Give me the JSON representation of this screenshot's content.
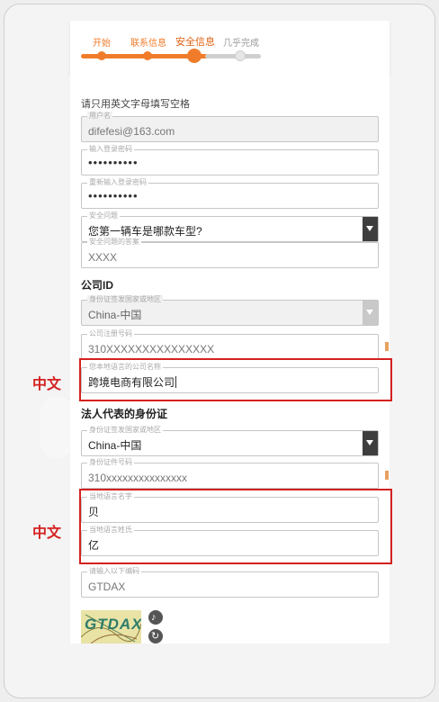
{
  "progress": {
    "steps": [
      {
        "label": "开始",
        "state": "done"
      },
      {
        "label": "联系信息",
        "state": "done"
      },
      {
        "label": "安全信息",
        "state": "active"
      },
      {
        "label": "几乎完成",
        "state": "todo"
      }
    ]
  },
  "hint": "请只用英文字母填写空格",
  "account": {
    "username": {
      "label": "用户名",
      "value": "difefesi@163.com"
    },
    "password": {
      "label": "输入登录密码",
      "value": "••••••••••"
    },
    "password_confirm": {
      "label": "重新输入登录密码",
      "value": "••••••••••"
    },
    "security_question": {
      "label": "安全问题",
      "value": "您第一辆车是哪款车型?"
    },
    "security_answer": {
      "label": "安全问题的答案",
      "value": "XXXX"
    }
  },
  "company": {
    "section_title": "公司ID",
    "country": {
      "label": "身份证签发国家或地区",
      "value": "China-中国"
    },
    "reg_number": {
      "label": "公司注册号码",
      "value": "310XXXXXXXXXXXXXXX"
    },
    "local_name": {
      "label": "您本地语言的公司名称",
      "value": "跨境电商有限公司"
    }
  },
  "legal_rep": {
    "section_title": "法人代表的身份证",
    "country": {
      "label": "身份证签发国家或地区",
      "value": "China-中国"
    },
    "id_number": {
      "label": "身份证件号码",
      "value": "310xxxxxxxxxxxxxxx"
    },
    "first_name": {
      "label": "当地语言名字",
      "value": "贝"
    },
    "last_name": {
      "label": "当地语言姓氏",
      "value": "亿"
    }
  },
  "verification": {
    "code": {
      "label": "请输入以下编码",
      "value": "GTDAX"
    },
    "captcha_text": "GTDAX"
  },
  "annotations": {
    "label_1": "中文",
    "label_2": "中文",
    "color": "#d42121"
  },
  "colors": {
    "accent": "#f07c2b"
  }
}
